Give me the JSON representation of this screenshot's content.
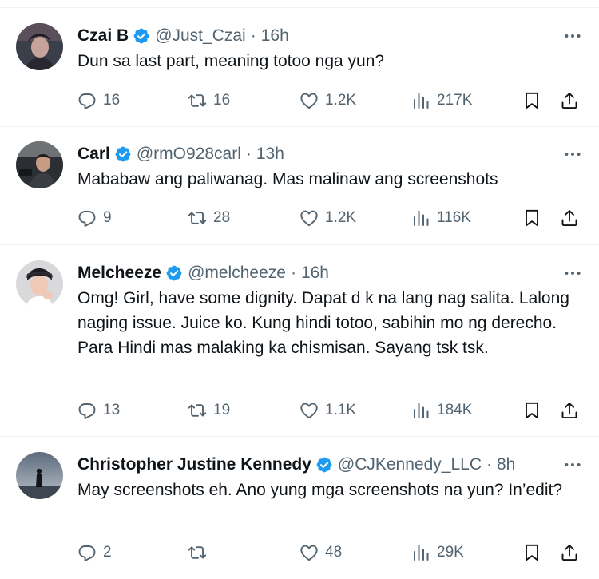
{
  "tweets": [
    {
      "name": "Czai B",
      "handle": "@Just_Czai",
      "time": "16h",
      "text": "Dun sa last part, meaning totoo nga yun?",
      "replies": "16",
      "retweets": "16",
      "likes": "1.2K",
      "views": "217K"
    },
    {
      "name": "Carl",
      "handle": "@rmO928carl",
      "time": "13h",
      "text": "Mababaw ang paliwanag. Mas malinaw ang screenshots",
      "replies": "9",
      "retweets": "28",
      "likes": "1.2K",
      "views": "116K"
    },
    {
      "name": "Melcheeze",
      "handle": "@melcheeze",
      "time": "16h",
      "text": "Omg! Girl, have some dignity. Dapat d k na lang nag salita. Lalong naging issue. Juice ko. Kung hindi totoo, sabihin mo ng derecho. Para Hindi mas malaking ka chismisan. Sayang tsk tsk.",
      "replies": "13",
      "retweets": "19",
      "likes": "1.1K",
      "views": "184K"
    },
    {
      "name": "Christopher Justine Kennedy",
      "handle": "@CJKennedy_LLC",
      "time": "8h",
      "text": "May screenshots eh. Ano yung mga screenshots na yun? In’edit?",
      "replies": "2",
      "retweets": "",
      "likes": "48",
      "views": "29K"
    }
  ],
  "separator": "·",
  "icons": [
    "verified-badge-icon",
    "more-icon",
    "reply-icon",
    "retweet-icon",
    "like-icon",
    "views-icon",
    "bookmark-icon",
    "share-icon"
  ],
  "colors": {
    "verified": "#1d9bf0",
    "muted": "#536471",
    "text": "#0f1419"
  }
}
